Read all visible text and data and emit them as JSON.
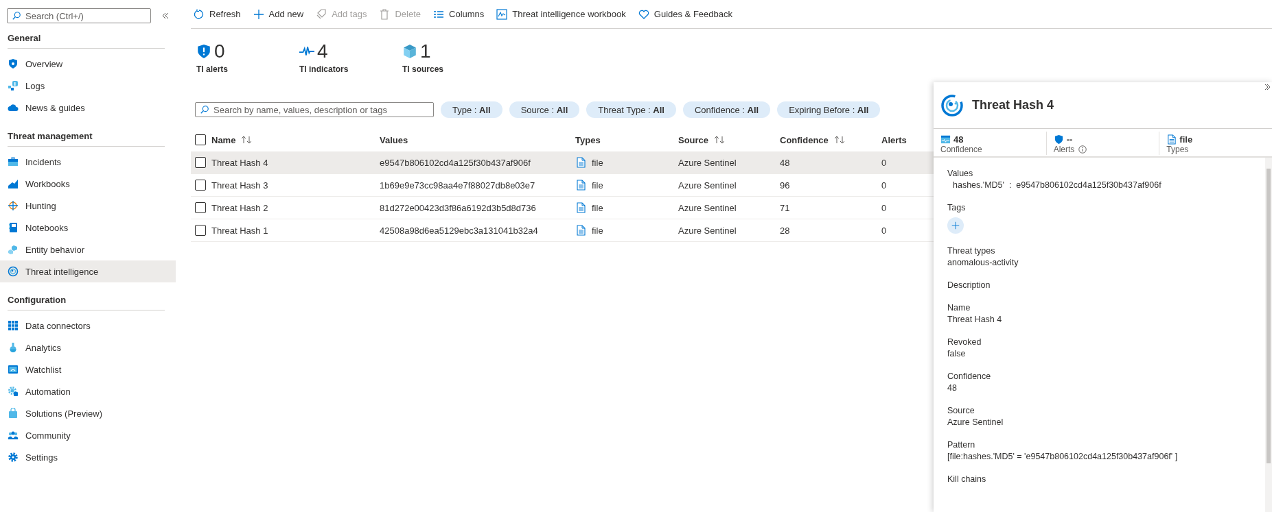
{
  "sidebar": {
    "search": {
      "placeholder": "Search (Ctrl+/)"
    },
    "sections": [
      {
        "title": "General",
        "items": [
          {
            "label": "Overview",
            "selected": false
          },
          {
            "label": "Logs",
            "selected": false
          },
          {
            "label": "News & guides",
            "selected": false
          }
        ]
      },
      {
        "title": "Threat management",
        "items": [
          {
            "label": "Incidents",
            "selected": false
          },
          {
            "label": "Workbooks",
            "selected": false
          },
          {
            "label": "Hunting",
            "selected": false
          },
          {
            "label": "Notebooks",
            "selected": false
          },
          {
            "label": "Entity behavior",
            "selected": false
          },
          {
            "label": "Threat intelligence",
            "selected": true
          }
        ]
      },
      {
        "title": "Configuration",
        "items": [
          {
            "label": "Data connectors",
            "selected": false
          },
          {
            "label": "Analytics",
            "selected": false
          },
          {
            "label": "Watchlist",
            "selected": false
          },
          {
            "label": "Automation",
            "selected": false
          },
          {
            "label": "Solutions (Preview)",
            "selected": false
          },
          {
            "label": "Community",
            "selected": false
          },
          {
            "label": "Settings",
            "selected": false
          }
        ]
      }
    ]
  },
  "toolbar": [
    {
      "label": "Refresh",
      "disabled": false
    },
    {
      "label": "Add new",
      "disabled": false
    },
    {
      "label": "Add tags",
      "disabled": true
    },
    {
      "label": "Delete",
      "disabled": true
    },
    {
      "label": "Columns",
      "disabled": false
    },
    {
      "label": "Threat intelligence workbook",
      "disabled": false
    },
    {
      "label": "Guides & Feedback",
      "disabled": false
    }
  ],
  "stats": [
    {
      "value": "0",
      "label": "TI alerts"
    },
    {
      "value": "4",
      "label": "TI indicators"
    },
    {
      "value": "1",
      "label": "TI sources"
    }
  ],
  "filters": {
    "search": {
      "placeholder": "Search by name, values, description or tags"
    },
    "chips": [
      {
        "label": "Type : ",
        "value": "All"
      },
      {
        "label": "Source : ",
        "value": "All"
      },
      {
        "label": "Threat Type : ",
        "value": "All"
      },
      {
        "label": "Confidence : ",
        "value": "All"
      },
      {
        "label": "Expiring Before : ",
        "value": "All"
      }
    ]
  },
  "table": {
    "select_all": {
      "checked": false
    },
    "columns": [
      {
        "label": "Name",
        "sortable": true
      },
      {
        "label": "Values",
        "sortable": false
      },
      {
        "label": "Types",
        "sortable": false
      },
      {
        "label": "Source",
        "sortable": true
      },
      {
        "label": "Confidence",
        "sortable": true
      },
      {
        "label": "Alerts",
        "sortable": false
      }
    ],
    "rows": [
      {
        "selected": true,
        "checked": false,
        "name": "Threat Hash 4",
        "value": "e9547b806102cd4a125f30b437af906f",
        "type": "file",
        "source": "Azure Sentinel",
        "confidence": "48",
        "alerts": "0"
      },
      {
        "selected": false,
        "checked": false,
        "name": "Threat Hash 3",
        "value": "1b69e9e73cc98aa4e7f88027db8e03e7",
        "type": "file",
        "source": "Azure Sentinel",
        "confidence": "96",
        "alerts": "0"
      },
      {
        "selected": false,
        "checked": false,
        "name": "Threat Hash 2",
        "value": "81d272e00423d3f86a6192d3b5d8d736",
        "type": "file",
        "source": "Azure Sentinel",
        "confidence": "71",
        "alerts": "0"
      },
      {
        "selected": false,
        "checked": false,
        "name": "Threat Hash 1",
        "value": "42508a98d6ea5129ebc3a131041b32a4",
        "type": "file",
        "source": "Azure Sentinel",
        "confidence": "28",
        "alerts": "0"
      }
    ]
  },
  "details": {
    "title": "Threat Hash 4",
    "stats": [
      {
        "value": "48",
        "label": "Confidence",
        "info": false
      },
      {
        "value": "--",
        "label": "Alerts",
        "info": true
      },
      {
        "value": "file",
        "label": "Types",
        "info": false
      }
    ],
    "fields": [
      {
        "kind": "text",
        "label": "Values",
        "value": "hashes.'MD5'  :  e9547b806102cd4a125f30b437af906f"
      },
      {
        "kind": "tags",
        "label": "Tags"
      },
      {
        "kind": "text",
        "label": "Threat types",
        "value": "anomalous-activity"
      },
      {
        "kind": "text",
        "label": "Description"
      },
      {
        "kind": "text",
        "label": "Name",
        "value": "Threat Hash 4"
      },
      {
        "kind": "text",
        "label": "Revoked",
        "value": "false"
      },
      {
        "kind": "text",
        "label": "Confidence",
        "value": "48"
      },
      {
        "kind": "text",
        "label": "Source",
        "value": "Azure Sentinel"
      },
      {
        "kind": "text",
        "label": "Pattern",
        "value": "[file:hashes.'MD5' = 'e9547b806102cd4a125f30b437af906f' ]"
      },
      {
        "kind": "text",
        "label": "Kill chains"
      }
    ]
  }
}
